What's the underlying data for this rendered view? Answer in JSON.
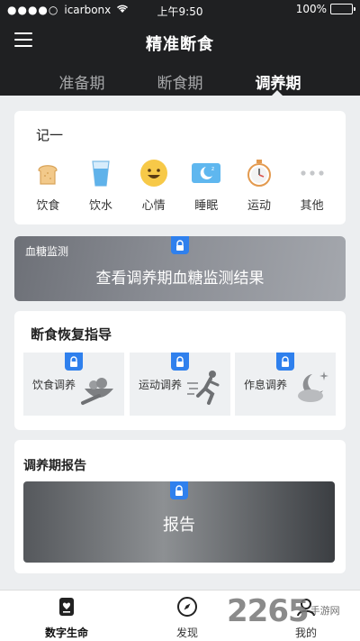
{
  "status": {
    "carrier": "icarbonx",
    "time": "上午9:50",
    "battery": "100%"
  },
  "header": {
    "title": "精准断食"
  },
  "tabs": [
    {
      "label": "准备期"
    },
    {
      "label": "断食期"
    },
    {
      "label": "调养期",
      "active": true
    }
  ],
  "record": {
    "title": "记一",
    "items": [
      {
        "label": "饮食",
        "icon": "bread-icon"
      },
      {
        "label": "饮水",
        "icon": "water-glass-icon"
      },
      {
        "label": "心情",
        "icon": "smiley-icon"
      },
      {
        "label": "睡眠",
        "icon": "sleep-moon-icon"
      },
      {
        "label": "运动",
        "icon": "stopwatch-icon"
      },
      {
        "label": "其他",
        "icon": "more-dots-icon"
      }
    ]
  },
  "glucose": {
    "tag": "血糖监测",
    "text": "查看调养期血糖监测结果"
  },
  "guide": {
    "title": "断食恢复指导",
    "items": [
      {
        "label": "饮食调养",
        "icon": "food-bowl-icon"
      },
      {
        "label": "运动调养",
        "icon": "runner-icon"
      },
      {
        "label": "作息调养",
        "icon": "moon-cloud-icon"
      }
    ]
  },
  "report": {
    "title": "调养期报告",
    "text": "报告"
  },
  "bottom_nav": [
    {
      "label": "数字生命",
      "icon": "digital-life-icon",
      "active": true
    },
    {
      "label": "发现",
      "icon": "compass-icon"
    },
    {
      "label": "我的",
      "icon": "profile-icon"
    }
  ],
  "watermark": {
    "big": "2265",
    "small": "手游网"
  },
  "colors": {
    "header_bg": "#1f2022",
    "accent_blue": "#2f80ed",
    "page_bg": "#eceef0"
  }
}
